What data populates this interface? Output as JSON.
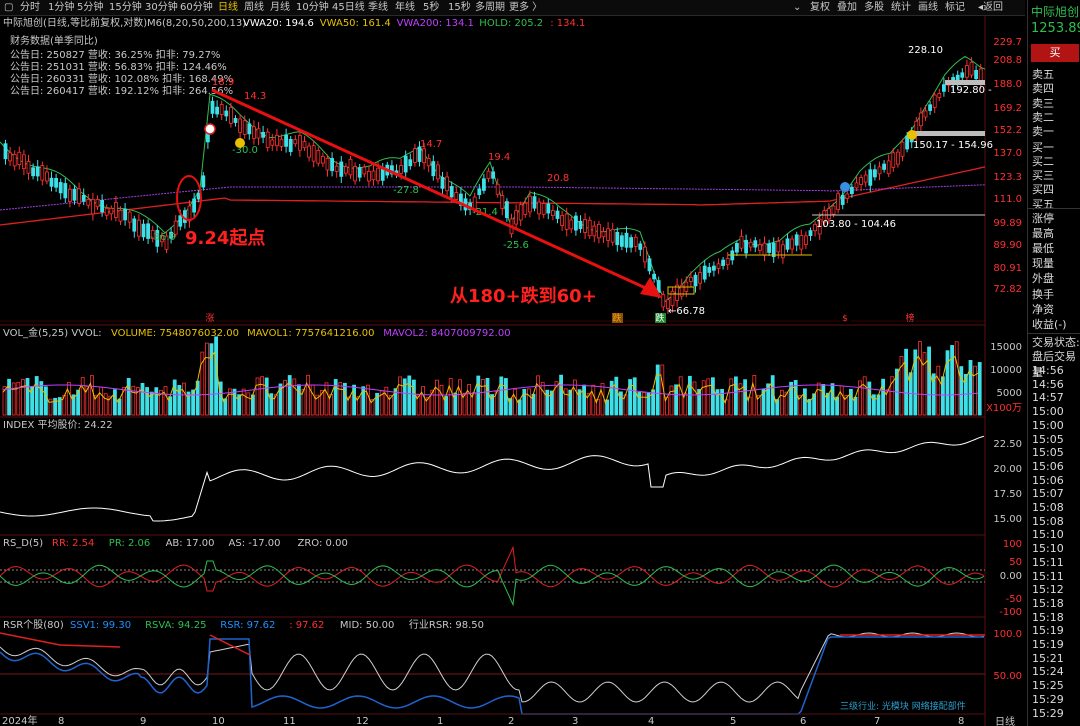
{
  "toolbar": {
    "timeframes": [
      "分时",
      "1分钟",
      "5分钟",
      "15分钟",
      "30分钟",
      "60分钟",
      "日线",
      "周线",
      "月线",
      "10分钟",
      "45日线",
      "季线",
      "年线",
      "5秒",
      "15秒",
      "多周期",
      "更多"
    ],
    "active_timeframe": "日线",
    "right_buttons": [
      "复权",
      "叠加",
      "多股",
      "统计",
      "画线",
      "标记"
    ],
    "back_label": "返回"
  },
  "stock": {
    "name": "中际旭创",
    "price": "1253.89",
    "buy_label": "买"
  },
  "main_chart": {
    "header": "中际旭创(日线,等比前复权,对数)",
    "indicator_name": "M6(8,20,50,200,13)",
    "indicator_values": [
      {
        "label": "VWA20: 194.6",
        "color": "#ffffff"
      },
      {
        "label": "VWA50: 161.4",
        "color": "#e8c000"
      },
      {
        "label": "VWA200: 134.1",
        "color": "#c040ff"
      },
      {
        "label": "HOLD: 205.2",
        "color": "#2fbf4f"
      },
      {
        "label": ": 134.1",
        "color": "#ff3030"
      }
    ],
    "finance_title": "财务数据(单季同比)",
    "finance_rows": [
      "公告日: 250827  营收: 36.25%  扣非: 79.27%",
      "公告日: 251031  营收: 56.83%  扣非: 124.46%",
      "公告日: 260331  营收: 102.08%  扣非: 168.49%",
      "公告日: 260417  营收: 192.12%  扣非: 264.56%"
    ],
    "price_axis": [
      "229.7",
      "208.8",
      "188.0",
      "169.2",
      "152.2",
      "137.0",
      "123.3",
      "111.0",
      "99.89",
      "89.90",
      "80.91",
      "72.82"
    ],
    "annotations": [
      {
        "text": "-36.9",
        "color": "#2fbf4f"
      },
      {
        "text": "18.9",
        "color": "#ff3030"
      },
      {
        "text": "14.3",
        "color": "#ff3030"
      },
      {
        "text": "-30.0",
        "color": "#2fbf4f"
      },
      {
        "text": "-27.8",
        "color": "#2fbf4f"
      },
      {
        "text": "14.7",
        "color": "#ff3030"
      },
      {
        "text": "19.4",
        "color": "#ff3030"
      },
      {
        "text": "-21.4",
        "color": "#2fbf4f"
      },
      {
        "text": "-25.6",
        "color": "#2fbf4f"
      },
      {
        "text": "20.8",
        "color": "#ff3030"
      },
      {
        "text": "←66.78",
        "color": "#ffffff"
      },
      {
        "text": "103.80 - 104.46",
        "color": "#ffffff"
      },
      {
        "text": "150.17 - 154.96",
        "color": "#ffffff"
      },
      {
        "text": "192.80 -",
        "color": "#ffffff"
      },
      {
        "text": "228.10",
        "color": "#ffffff"
      }
    ],
    "callout_start": "9.24起点",
    "callout_drop": "从180+跌到60+",
    "markers": [
      "涨",
      "跌",
      "跌",
      "$",
      "榜"
    ]
  },
  "volume": {
    "title": "VOL_金(5,25) VVOL:",
    "values": [
      {
        "label": "VOLUME: 7548076032.00",
        "color": "#e8c000"
      },
      {
        "label": "MAVOL1: 7757641216.00",
        "color": "#e8c000"
      },
      {
        "label": "MAVOL2: 8407009792.00",
        "color": "#c040ff"
      }
    ],
    "axis": [
      "15000",
      "10000",
      "5000",
      "X100万"
    ]
  },
  "index_panel": {
    "title": "INDEX  平均股价: 24.22",
    "axis": [
      "22.50",
      "20.00",
      "17.50",
      "15.00"
    ]
  },
  "rs_panel": {
    "title": "RS_D(5)",
    "values": [
      {
        "label": "RR: 2.54",
        "color": "#ff3030"
      },
      {
        "label": "PR: 2.06",
        "color": "#2fbf4f"
      },
      {
        "label": "AB: 17.00",
        "color": "#c8c8c8"
      },
      {
        "label": "AS: -17.00",
        "color": "#c8c8c8"
      },
      {
        "label": "ZRO: 0.00",
        "color": "#c8c8c8"
      }
    ],
    "axis": [
      "100",
      "50",
      "0.00",
      "-50",
      "-100"
    ]
  },
  "rsr_panel": {
    "title": "RSR个股(80)",
    "values": [
      {
        "label": "SSV1: 99.30",
        "color": "#1e90ff"
      },
      {
        "label": "RSVA: 94.25",
        "color": "#2fbf4f"
      },
      {
        "label": "RSR: 97.62",
        "color": "#1e90ff"
      },
      {
        "label": ": 97.62",
        "color": "#ff3030"
      },
      {
        "label": "MID: 50.00",
        "color": "#c8c8c8"
      },
      {
        "label": "行业RSR: 98.50",
        "color": "#c8c8c8"
      }
    ],
    "axis": [
      "100.0",
      "50.00"
    ],
    "footer": "三级行业: 光模块    网络接配部件"
  },
  "x_axis": [
    "2024年",
    "8",
    "9",
    "10",
    "11",
    "12",
    "1",
    "2",
    "3",
    "4",
    "5",
    "6",
    "7",
    "8"
  ],
  "bottom_right_label": "日线",
  "order_book": {
    "asks": [
      "卖五",
      "卖四",
      "卖三",
      "卖二",
      "卖一"
    ],
    "bids": [
      "买一",
      "买二",
      "买三",
      "买四",
      "买五"
    ],
    "stats": [
      "涨停",
      "最高",
      "最低",
      "现量",
      "外盘",
      "换手",
      "净资",
      "收益(-)"
    ],
    "trade_status": "交易状态:",
    "after_hours": "盘后交易量",
    "times": [
      "14:56",
      "14:56",
      "14:57",
      "15:00",
      "15:00",
      "15:05",
      "15:05",
      "15:06",
      "15:06",
      "15:07",
      "15:08",
      "15:08",
      "15:10",
      "15:10",
      "15:11",
      "15:11",
      "15:12",
      "15:18",
      "15:18",
      "15:19",
      "15:19",
      "15:21",
      "15:24",
      "15:25",
      "15:29",
      "15:29"
    ]
  },
  "colors": {
    "up": "#ff3030",
    "down": "#3ee0e8",
    "green": "#2fbf4f",
    "accent": "#e8c000"
  }
}
